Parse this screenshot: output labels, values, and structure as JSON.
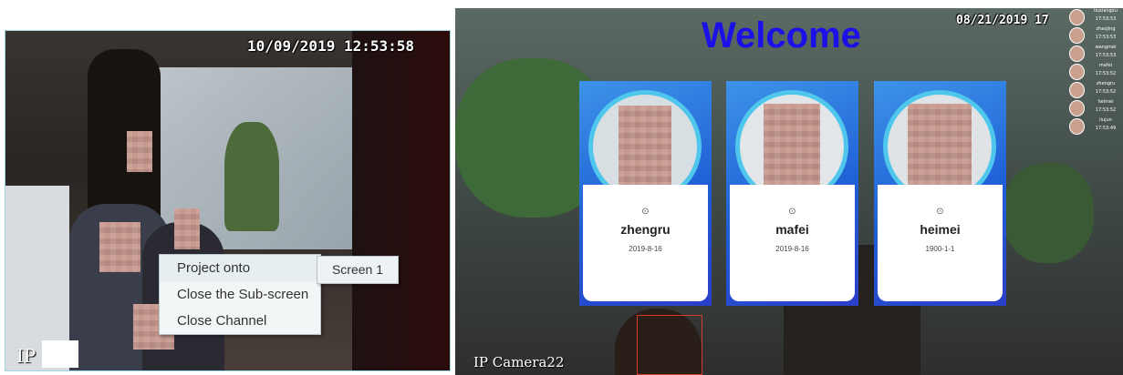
{
  "left_view": {
    "timestamp": "10/09/2019 12:53:58",
    "channel_label": "IP",
    "context_menu": {
      "items": [
        "Project onto",
        "Close the Sub-screen",
        "Close Channel"
      ],
      "submenu_item": "Screen 1"
    }
  },
  "right_view": {
    "timestamp": "08/21/2019 17",
    "welcome_text": "Welcome",
    "channel_label": "IP Camera22",
    "cards": [
      {
        "name": "zhengru",
        "date": "2019-8-16"
      },
      {
        "name": "mafei",
        "date": "2019-8-16"
      },
      {
        "name": "heimei",
        "date": "1900-1-1"
      }
    ],
    "recognition_list": [
      {
        "name": "liuxiangxu",
        "time": "17:53:53"
      },
      {
        "name": "zhaojing",
        "time": "17:53:53"
      },
      {
        "name": "wangmei",
        "time": "17:53:53"
      },
      {
        "name": "mafei",
        "time": "17:53:52"
      },
      {
        "name": "zhengru",
        "time": "17:53:52"
      },
      {
        "name": "heimei",
        "time": "17:53:52"
      },
      {
        "name": "liujun",
        "time": "17:53:49"
      }
    ]
  },
  "colors": {
    "welcome": "#1b10e8",
    "card_gradient": "#2a62d8",
    "photo_ring": "#4fc7ec",
    "menu_background": "#f3f6f7"
  },
  "icons": [
    "badge-icon"
  ]
}
